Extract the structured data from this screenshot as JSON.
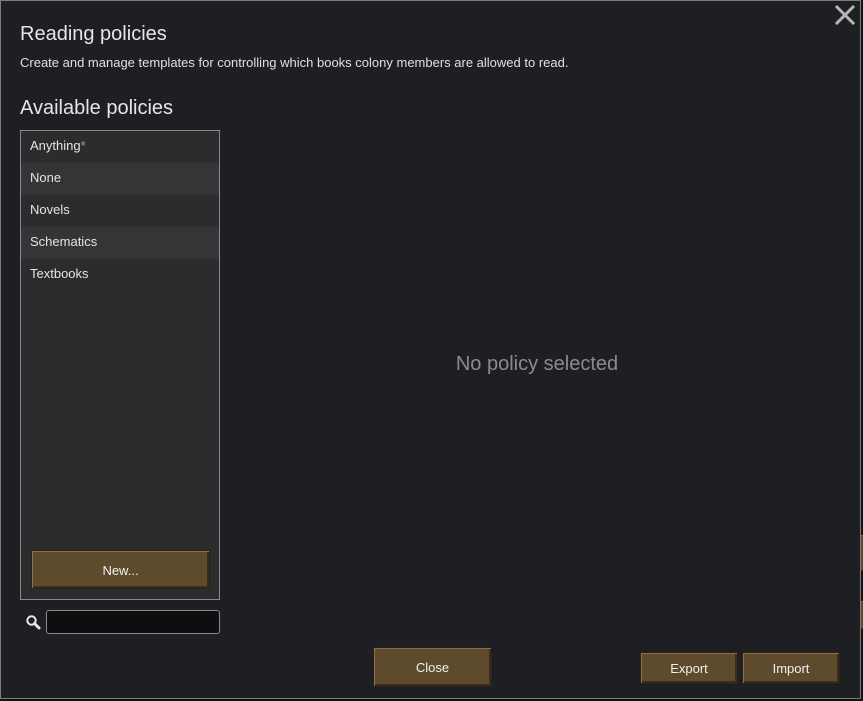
{
  "dialog": {
    "title": "Reading policies",
    "subtitle": "Create and manage templates for controlling which books colony members are allowed to read.",
    "close_icon": "close-icon"
  },
  "policies": {
    "section_title": "Available policies",
    "items": [
      {
        "label": "Anything",
        "marker": "*"
      },
      {
        "label": "None",
        "marker": ""
      },
      {
        "label": "Novels",
        "marker": ""
      },
      {
        "label": "Schematics",
        "marker": ""
      },
      {
        "label": "Textbooks",
        "marker": ""
      }
    ],
    "new_button": "New..."
  },
  "search": {
    "icon": "search-icon",
    "value": "",
    "placeholder": ""
  },
  "detail": {
    "empty_message": "No policy selected"
  },
  "footer": {
    "close_label": "Close",
    "export_label": "Export",
    "import_label": "Import"
  },
  "colors": {
    "dialog_bg": "#1d1f23",
    "list_bg": "#2b2c2e",
    "button_brown": "#5e4b2e",
    "muted_text": "#8b8b8b"
  }
}
